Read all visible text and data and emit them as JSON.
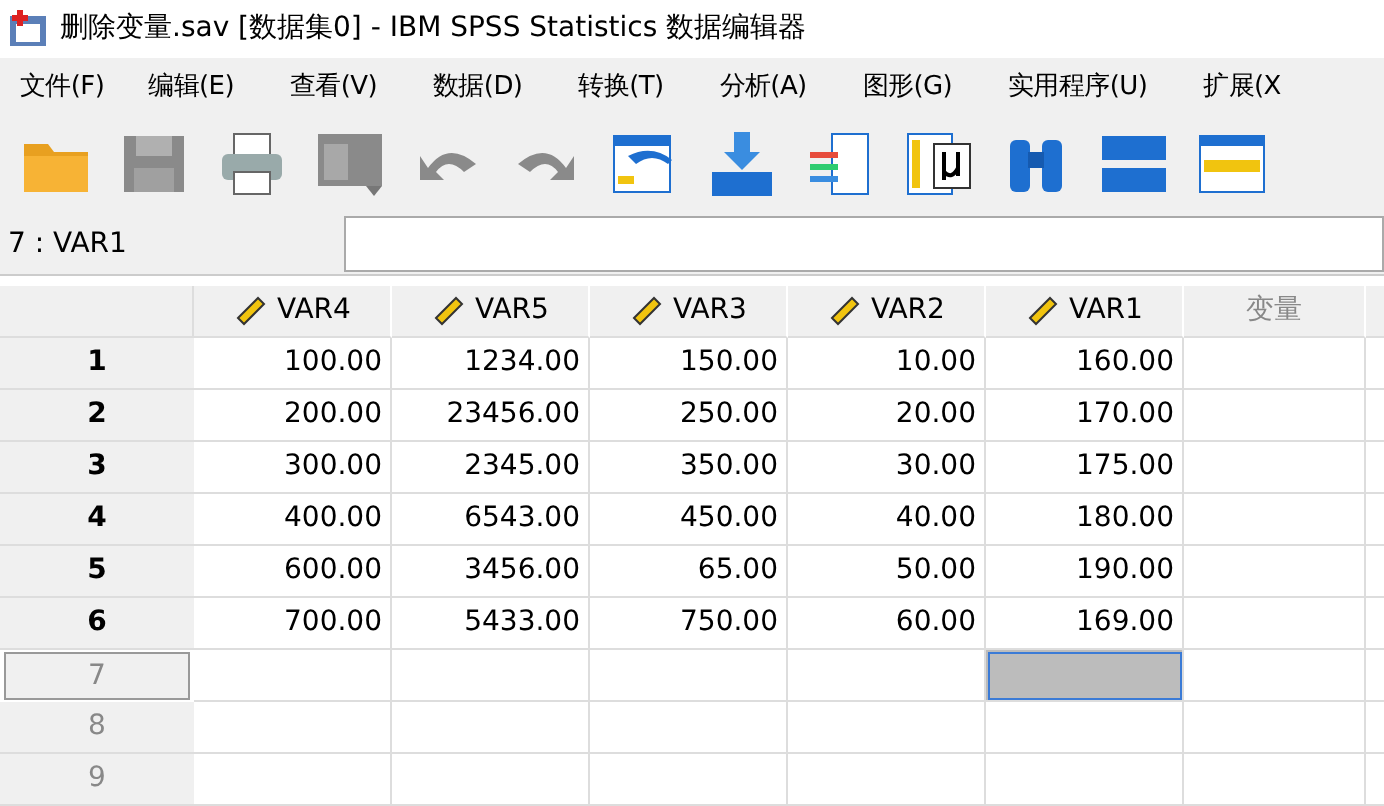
{
  "window": {
    "title": "删除变量.sav [数据集0] - IBM SPSS Statistics 数据编辑器"
  },
  "menu": [
    {
      "label": "文件(F)"
    },
    {
      "label": "编辑(E)"
    },
    {
      "label": "查看(V)"
    },
    {
      "label": "数据(D)"
    },
    {
      "label": "转换(T)"
    },
    {
      "label": "分析(A)"
    },
    {
      "label": "图形(G)"
    },
    {
      "label": "实用程序(U)"
    },
    {
      "label": "扩展(X"
    }
  ],
  "cell_reference": "7 : VAR1",
  "table": {
    "columns": [
      {
        "label": "VAR4",
        "kind": "scale"
      },
      {
        "label": "VAR5",
        "kind": "scale"
      },
      {
        "label": "VAR3",
        "kind": "scale"
      },
      {
        "label": "VAR2",
        "kind": "scale"
      },
      {
        "label": "VAR1",
        "kind": "scale"
      },
      {
        "label": "变量",
        "kind": "placeholder"
      }
    ],
    "rows": [
      {
        "number": "1",
        "kind": "data",
        "selected": false,
        "cells": [
          {
            "value": "100.00",
            "selected": false
          },
          {
            "value": "1234.00",
            "selected": false
          },
          {
            "value": "150.00",
            "selected": false
          },
          {
            "value": "10.00",
            "selected": false
          },
          {
            "value": "160.00",
            "selected": false
          }
        ]
      },
      {
        "number": "2",
        "kind": "data",
        "selected": false,
        "cells": [
          {
            "value": "200.00",
            "selected": false
          },
          {
            "value": "23456.00",
            "selected": false
          },
          {
            "value": "250.00",
            "selected": false
          },
          {
            "value": "20.00",
            "selected": false
          },
          {
            "value": "170.00",
            "selected": false
          }
        ]
      },
      {
        "number": "3",
        "kind": "data",
        "selected": false,
        "cells": [
          {
            "value": "300.00",
            "selected": false
          },
          {
            "value": "2345.00",
            "selected": false
          },
          {
            "value": "350.00",
            "selected": false
          },
          {
            "value": "30.00",
            "selected": false
          },
          {
            "value": "175.00",
            "selected": false
          }
        ]
      },
      {
        "number": "4",
        "kind": "data",
        "selected": false,
        "cells": [
          {
            "value": "400.00",
            "selected": false
          },
          {
            "value": "6543.00",
            "selected": false
          },
          {
            "value": "450.00",
            "selected": false
          },
          {
            "value": "40.00",
            "selected": false
          },
          {
            "value": "180.00",
            "selected": false
          }
        ]
      },
      {
        "number": "5",
        "kind": "data",
        "selected": false,
        "cells": [
          {
            "value": "600.00",
            "selected": false
          },
          {
            "value": "3456.00",
            "selected": false
          },
          {
            "value": "65.00",
            "selected": false
          },
          {
            "value": "50.00",
            "selected": false
          },
          {
            "value": "190.00",
            "selected": false
          }
        ]
      },
      {
        "number": "6",
        "kind": "data",
        "selected": false,
        "cells": [
          {
            "value": "700.00",
            "selected": false
          },
          {
            "value": "5433.00",
            "selected": false
          },
          {
            "value": "750.00",
            "selected": false
          },
          {
            "value": "60.00",
            "selected": false
          },
          {
            "value": "169.00",
            "selected": false
          }
        ]
      },
      {
        "number": "7",
        "kind": "empty",
        "selected": true,
        "cells": [
          {
            "selected": false
          },
          {
            "selected": false
          },
          {
            "selected": false
          },
          {
            "selected": false
          },
          {
            "selected": true
          }
        ]
      },
      {
        "number": "8",
        "kind": "empty",
        "selected": false,
        "cells": [
          {
            "selected": false
          },
          {
            "selected": false
          },
          {
            "selected": false
          },
          {
            "selected": false
          },
          {
            "selected": false
          }
        ]
      },
      {
        "number": "9",
        "kind": "empty",
        "selected": false,
        "cells": [
          {
            "selected": false
          },
          {
            "selected": false
          },
          {
            "selected": false
          },
          {
            "selected": false
          },
          {
            "selected": false
          }
        ]
      }
    ]
  }
}
